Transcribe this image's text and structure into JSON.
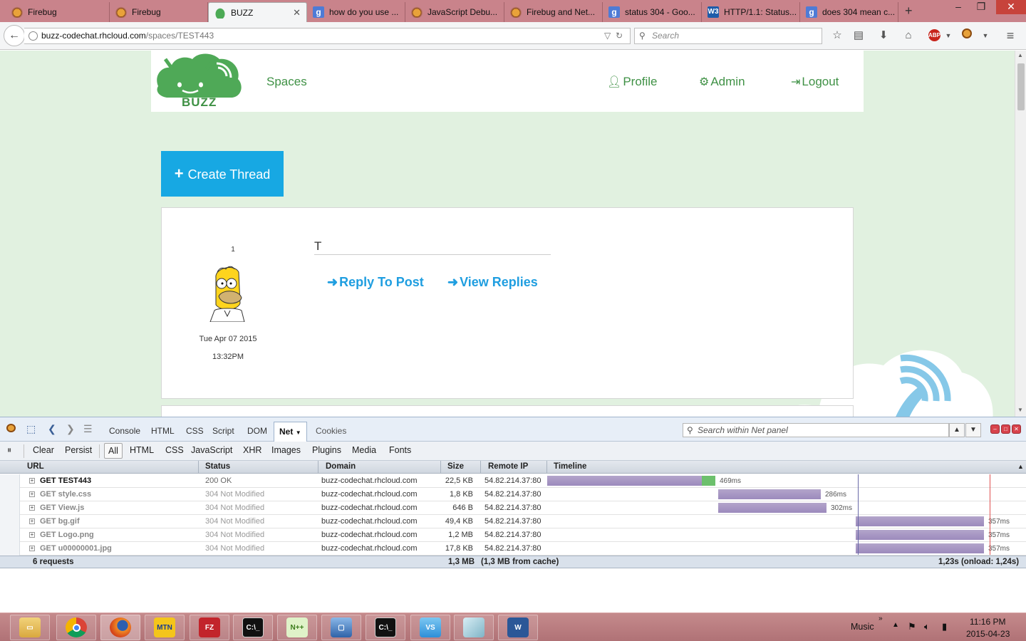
{
  "browser": {
    "tabs": [
      {
        "title": "Firebug",
        "icon": "firebug-icon"
      },
      {
        "title": "Firebug",
        "icon": "firebug-icon"
      },
      {
        "title": "BUZZ",
        "icon": "buzz-icon"
      },
      {
        "title": "how do you use ...",
        "icon": "google-icon"
      },
      {
        "title": "JavaScript Debu...",
        "icon": "firebug-icon"
      },
      {
        "title": "Firebug and Net...",
        "icon": "firebug-icon"
      },
      {
        "title": "status 304 - Goo...",
        "icon": "google-icon"
      },
      {
        "title": "HTTP/1.1: Status...",
        "icon": "w3c-icon"
      },
      {
        "title": "does 304 mean c...",
        "icon": "google-icon"
      }
    ],
    "url_domain": "buzz-codechat.rhcloud.com",
    "url_path": "/spaces/TEST443",
    "search_placeholder": "Search"
  },
  "site": {
    "logo_text": "BUZZ",
    "nav": {
      "spaces": "Spaces",
      "profile": "Profile",
      "admin": "Admin",
      "logout": "Logout"
    },
    "create_thread": "Create Thread",
    "post": {
      "count": "1",
      "date": "Tue Apr 07 2015",
      "time": "13:32PM",
      "title": "T",
      "reply": "Reply To Post",
      "view_replies": "View Replies"
    },
    "colors": {
      "brand_green": "#3f9145",
      "link_blue": "#1f9ee0",
      "button_blue": "#17a8e3",
      "page_bg": "#e1f1e0"
    }
  },
  "firebug": {
    "tabs": [
      "Console",
      "HTML",
      "CSS",
      "Script",
      "DOM",
      "Net",
      "Cookies"
    ],
    "active_tab": "Net",
    "search_placeholder": "Search within Net panel",
    "toolbar": {
      "clear": "Clear",
      "persist": "Persist"
    },
    "filters": [
      "All",
      "HTML",
      "CSS",
      "JavaScript",
      "XHR",
      "Images",
      "Plugins",
      "Media",
      "Fonts"
    ],
    "columns": {
      "url": "URL",
      "status": "Status",
      "domain": "Domain",
      "size": "Size",
      "remote_ip": "Remote IP",
      "timeline": "Timeline"
    },
    "requests": [
      {
        "url": "GET TEST443",
        "status": "200 OK",
        "domain": "buzz-codechat.rhcloud.com",
        "size": "22,5 KB",
        "ip": "54.82.214.37:80",
        "duration": "469ms",
        "start": 0.0,
        "wait": 0.92,
        "receive": 0.08
      },
      {
        "url": "GET style.css",
        "status": "304 Not Modified",
        "domain": "buzz-codechat.rhcloud.com",
        "size": "1,8 KB",
        "ip": "54.82.214.37:80",
        "duration": "286ms",
        "start": 0.387,
        "wait": 1.0,
        "receive": 0.0
      },
      {
        "url": "GET View.js",
        "status": "304 Not Modified",
        "domain": "buzz-codechat.rhcloud.com",
        "size": "646 B",
        "ip": "54.82.214.37:80",
        "duration": "302ms",
        "start": 0.387,
        "wait": 1.0,
        "receive": 0.0
      },
      {
        "url": "GET bg.gif",
        "status": "304 Not Modified",
        "domain": "buzz-codechat.rhcloud.com",
        "size": "49,4 KB",
        "ip": "54.82.214.37:80",
        "duration": "357ms",
        "start": 0.698,
        "wait": 1.0,
        "receive": 0.0
      },
      {
        "url": "GET Logo.png",
        "status": "304 Not Modified",
        "domain": "buzz-codechat.rhcloud.com",
        "size": "1,2 MB",
        "ip": "54.82.214.37:80",
        "duration": "357ms",
        "start": 0.698,
        "wait": 1.0,
        "receive": 0.0
      },
      {
        "url": "GET u00000001.jpg",
        "status": "304 Not Modified",
        "domain": "buzz-codechat.rhcloud.com",
        "size": "17,8 KB",
        "ip": "54.82.214.37:80",
        "duration": "357ms",
        "start": 0.698,
        "wait": 1.0,
        "receive": 0.0
      }
    ],
    "summary": {
      "count": "6 requests",
      "size": "1,3 MB",
      "cache": "(1,3 MB from cache)",
      "timing": "1,23s (onload: 1,24s)"
    }
  },
  "taskbar": {
    "apps": [
      "file-explorer-icon",
      "chrome-icon",
      "firefox-icon",
      "mtn-icon",
      "filezilla-icon",
      "cmd-icon",
      "notepad-plus-icon",
      "virtualbox-icon",
      "cmd-icon",
      "visual-studio-icon",
      "paper-icon",
      "word-icon"
    ],
    "tray_label": "Music",
    "time": "11:16 PM",
    "date": "2015-04-23"
  }
}
